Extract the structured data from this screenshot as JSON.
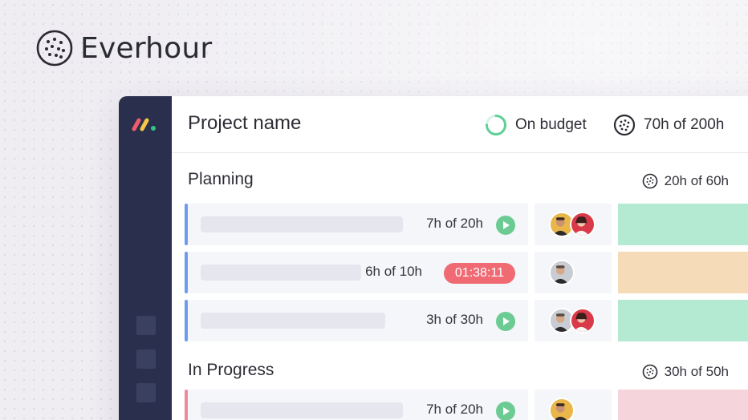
{
  "brand": {
    "name": "Everhour"
  },
  "header": {
    "project_name": "Project name",
    "budget_status": "On budget",
    "total_time": "70h of 200h"
  },
  "groups": [
    {
      "title": "Planning",
      "estimate": "20h of 60h",
      "rows": [
        {
          "time": "7h of 20h",
          "control": "play",
          "assignees": [
            "man-beard-yellow",
            "woman-red"
          ],
          "status_color": "#b4ead2",
          "accent_color": "#6b9cf0"
        },
        {
          "time": "6h of 10h",
          "control": "timer",
          "timer": "01:38:11",
          "assignees": [
            "man-gray"
          ],
          "status_color": "#f5dbb8",
          "accent_color": "#6b9cf0"
        },
        {
          "time": "3h of 30h",
          "control": "play",
          "assignees": [
            "man-gray",
            "woman-red"
          ],
          "status_color": "#b4ead2",
          "accent_color": "#6b9cf0"
        }
      ]
    },
    {
      "title": "In Progress",
      "estimate": "30h of 50h",
      "rows": [
        {
          "time": "7h of 20h",
          "control": "play",
          "assignees": [
            "man-beard-yellow"
          ],
          "status_color": "#f5d4dc",
          "accent_color": "#ef8a9a"
        }
      ]
    }
  ],
  "colors": {
    "sidebar": "#292f4c",
    "play": "#6ccb92",
    "timer": "#ef6a73",
    "budget_ring": "#5fcf95"
  },
  "icons": [
    "everhour-logo-icon",
    "monday-logo-icon",
    "budget-ring-icon",
    "stopwatch-icon",
    "play-icon"
  ]
}
